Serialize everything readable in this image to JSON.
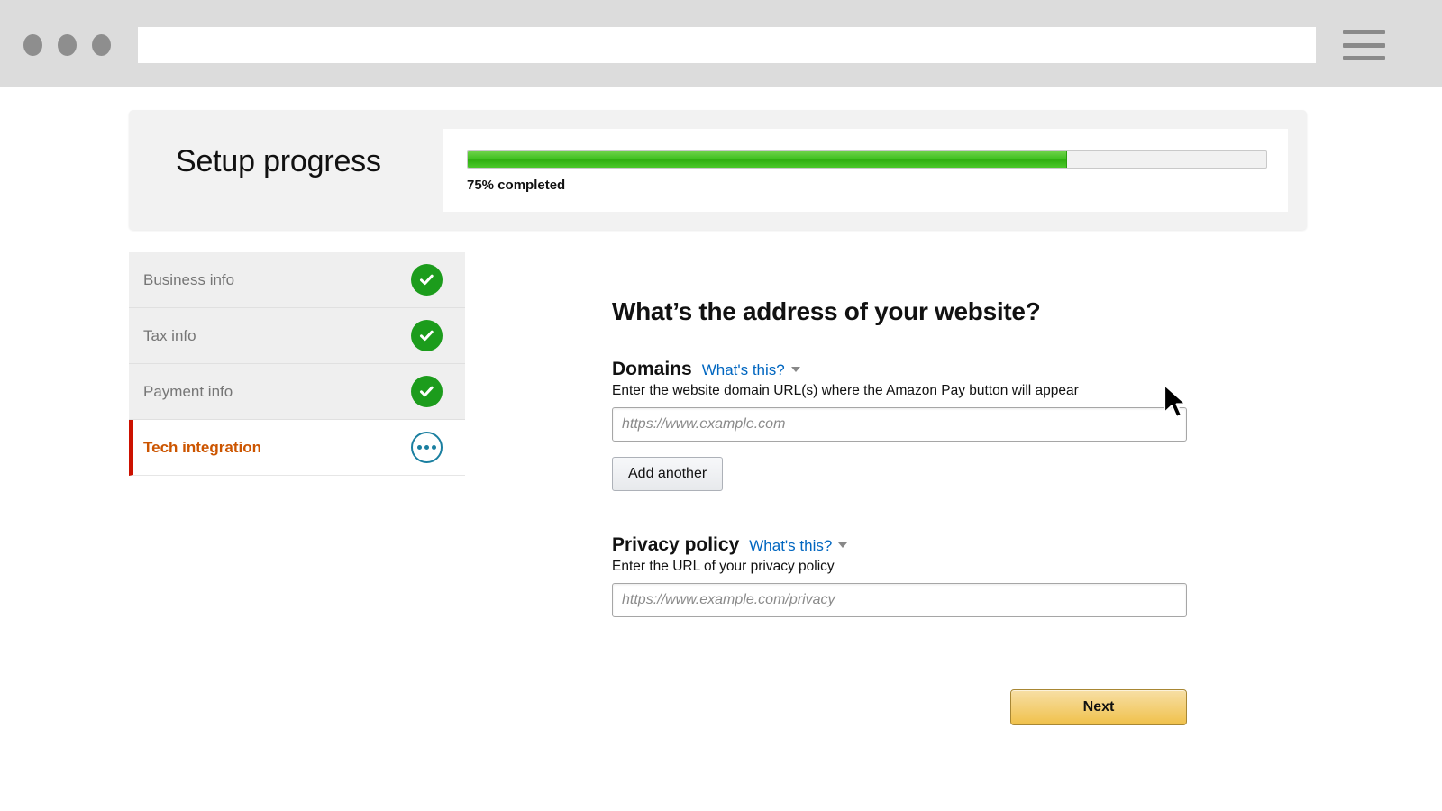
{
  "browser": {
    "window_controls": [
      "close",
      "minimize",
      "maximize"
    ],
    "address_bar_value": "",
    "address_bar_placeholder": "",
    "menu_icon": "hamburger-menu-icon"
  },
  "progress_card": {
    "title": "Setup progress",
    "percent": 75,
    "percent_label": "75% completed",
    "fill_color": "#3fbf1f",
    "track_color": "#f1f1f1"
  },
  "steps": [
    {
      "label": "Business info",
      "state": "complete",
      "icon": "check-icon"
    },
    {
      "label": "Tax info",
      "state": "complete",
      "icon": "check-icon"
    },
    {
      "label": "Payment info",
      "state": "complete",
      "icon": "check-icon"
    },
    {
      "label": "Tech integration",
      "state": "current",
      "icon": "ellipsis-icon",
      "accent_color": "#cc5500",
      "marker_color": "#cc1100"
    }
  ],
  "form": {
    "heading": "What’s the address of your website?",
    "domains": {
      "title": "Domains",
      "help_link": "What's this?",
      "description": "Enter the website domain URL(s) where the Amazon Pay button will appear",
      "input_value": "",
      "input_placeholder": "https://www.example.com",
      "add_button": "Add another"
    },
    "privacy": {
      "title": "Privacy policy",
      "help_link": "What's this?",
      "description": "Enter the URL of your privacy policy",
      "input_value": "",
      "input_placeholder": "https://www.example.com/privacy"
    },
    "next_button": "Next"
  },
  "colors": {
    "accent_link": "#0066c0",
    "success_green": "#1c9c1c",
    "current_step_orange": "#cc5500",
    "current_step_marker": "#cc1100",
    "next_button_gold": "#f0c14b",
    "current_icon_blue": "#1a7fa0"
  }
}
